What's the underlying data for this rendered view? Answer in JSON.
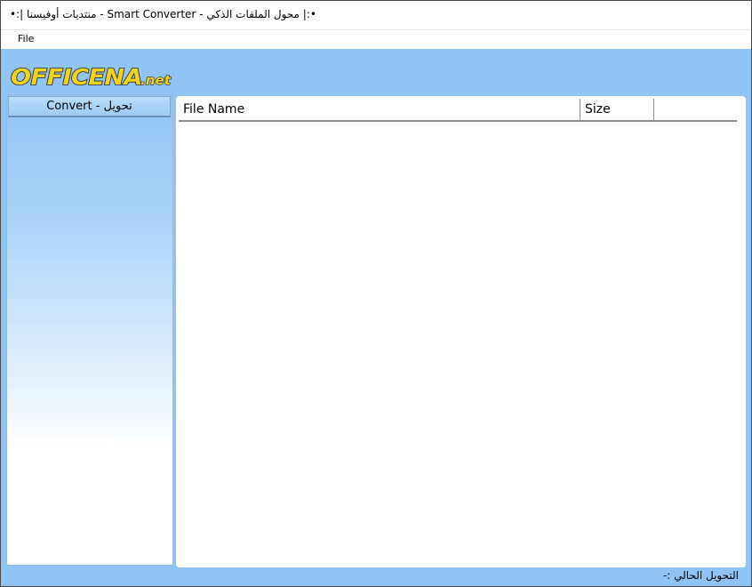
{
  "window": {
    "title": "•:| محول الملفات الذكي - Smart Converter - منتديات أوفيسنا |:•"
  },
  "menu": {
    "items": [
      "File"
    ]
  },
  "logo": {
    "text": "OFFICENA",
    "suffix": ".net"
  },
  "sidebar": {
    "convert_label": "Convert - تحويل"
  },
  "file_list": {
    "columns": [
      "File Name",
      "Size"
    ],
    "rows": []
  },
  "status": {
    "current_conversion": "التحويل الحالي :-"
  },
  "colors": {
    "workspace_bg": "#8fc4f5",
    "logo_fill": "#f2d31a",
    "logo_outline": "#2a2a2a"
  }
}
